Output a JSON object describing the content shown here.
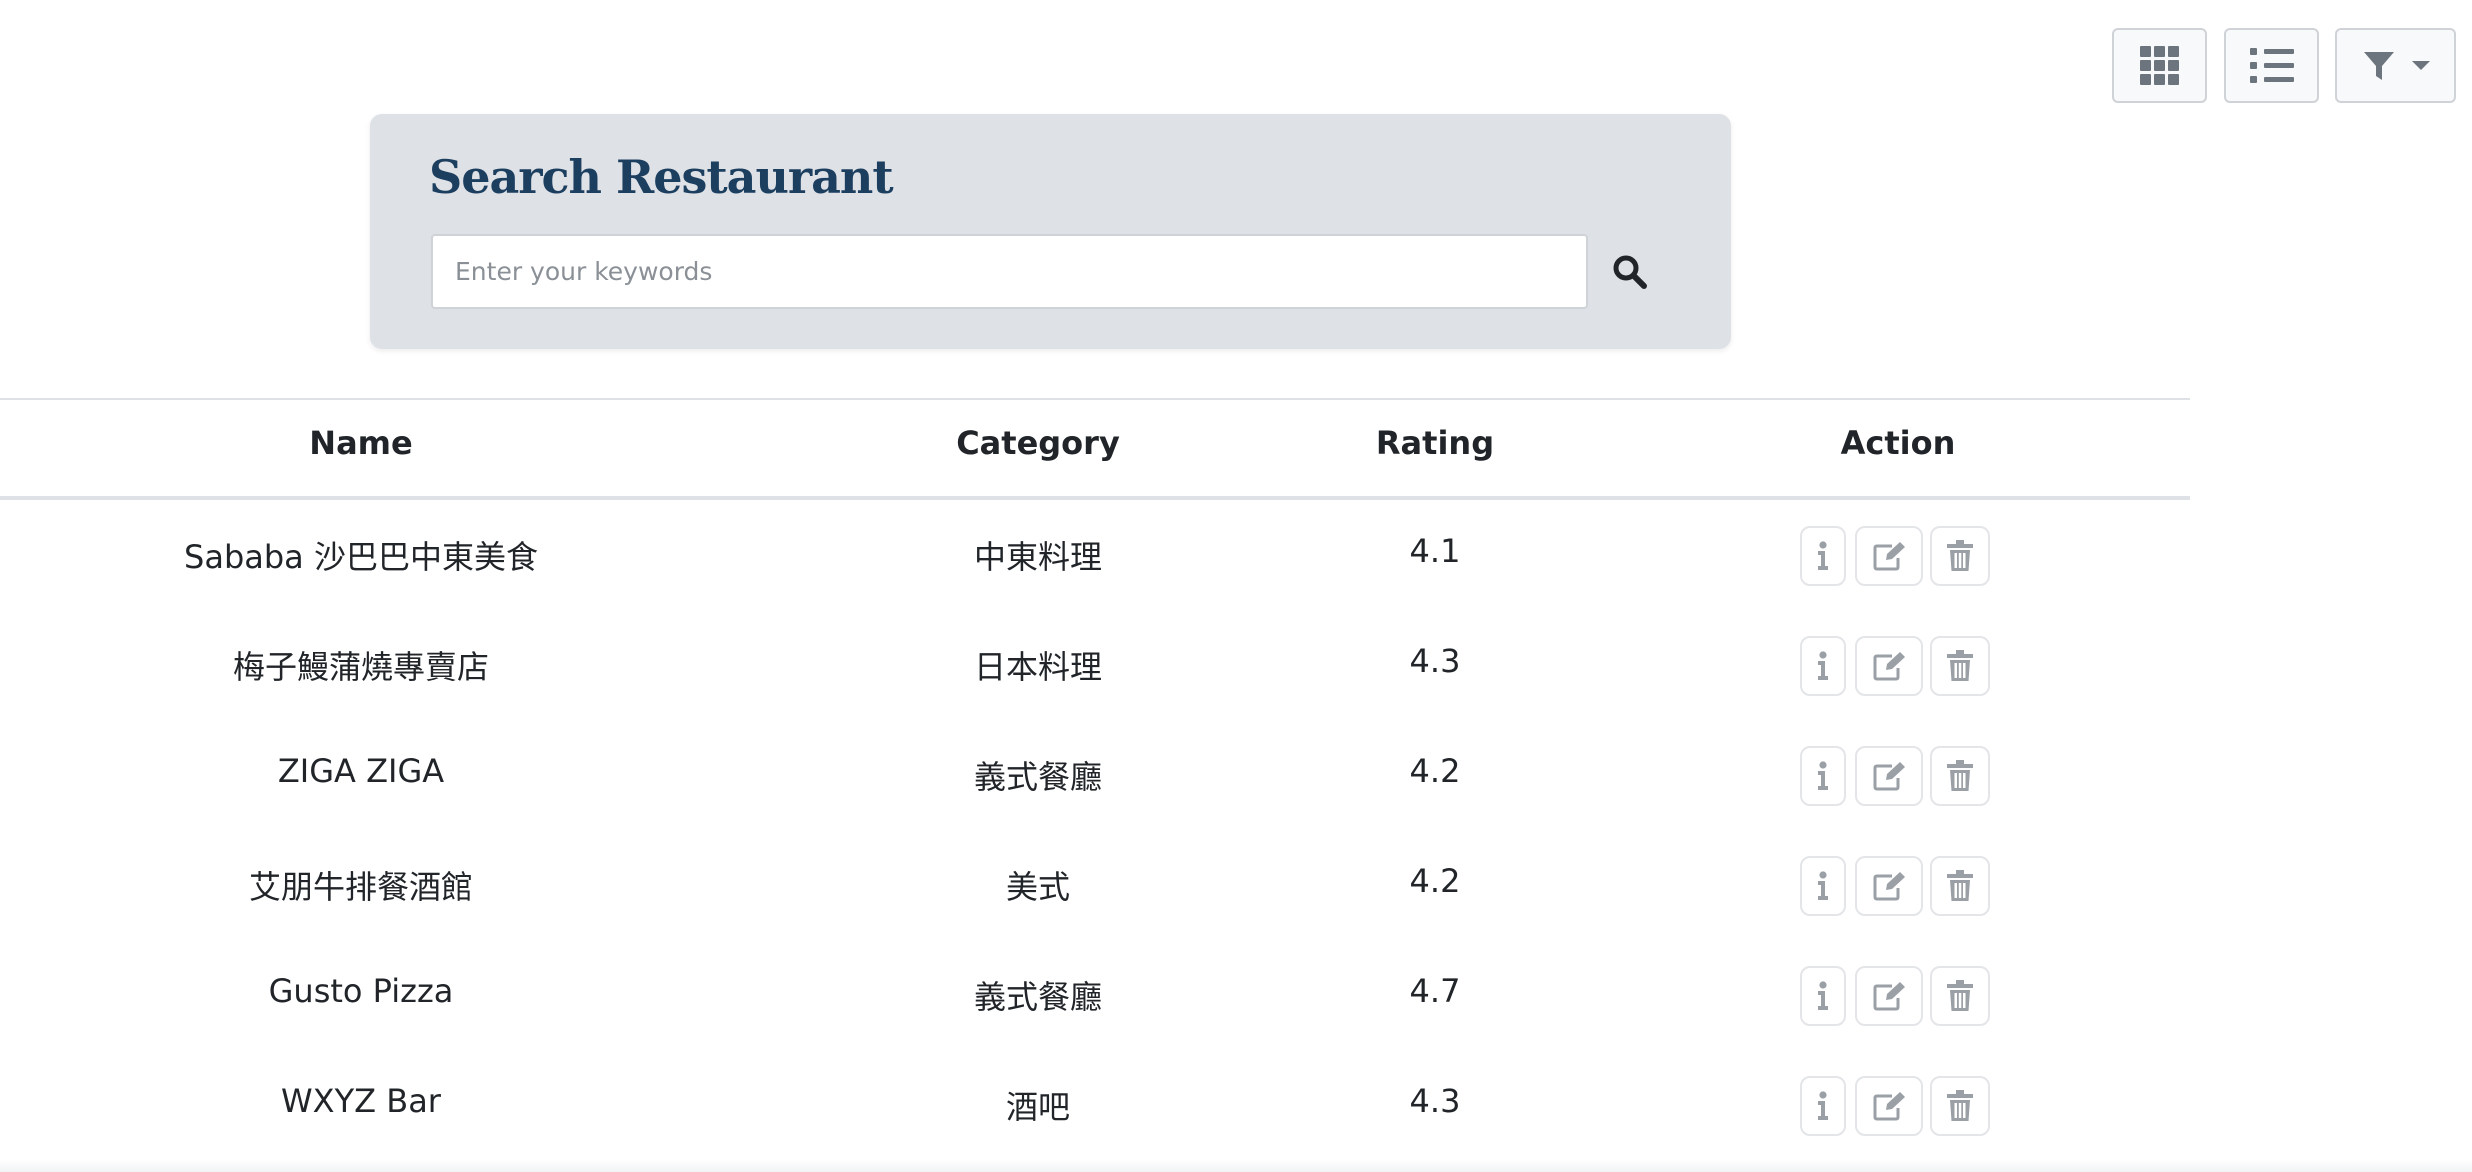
{
  "toolbar": {
    "grid_view_icon": "grid-icon",
    "list_view_icon": "list-icon",
    "filter_icon": "filter-icon",
    "filter_caret_icon": "caret-down-icon"
  },
  "search": {
    "title": "Search Restaurant",
    "placeholder": "Enter your keywords",
    "value": "",
    "button_icon": "search-icon"
  },
  "table": {
    "headers": {
      "name": "Name",
      "category": "Category",
      "rating": "Rating",
      "action": "Action"
    },
    "rows": [
      {
        "name": "Sababa 沙巴巴中東美食",
        "category": "中東料理",
        "rating": "4.1"
      },
      {
        "name": "梅子鰻蒲燒專賣店",
        "category": "日本料理",
        "rating": "4.3"
      },
      {
        "name": "ZIGA ZIGA",
        "category": "義式餐廳",
        "rating": "4.2"
      },
      {
        "name": "艾朋牛排餐酒館",
        "category": "美式",
        "rating": "4.2"
      },
      {
        "name": "Gusto Pizza",
        "category": "義式餐廳",
        "rating": "4.7"
      },
      {
        "name": "WXYZ Bar",
        "category": "酒吧",
        "rating": "4.3"
      }
    ],
    "action_icons": [
      "info-icon",
      "edit-icon",
      "trash-icon"
    ]
  },
  "colors": {
    "panel_bg": "#dee1e6",
    "title_color": "#1c3f60",
    "icon_gray": "#6c757d",
    "action_icon_gray": "#9aa0a6"
  }
}
